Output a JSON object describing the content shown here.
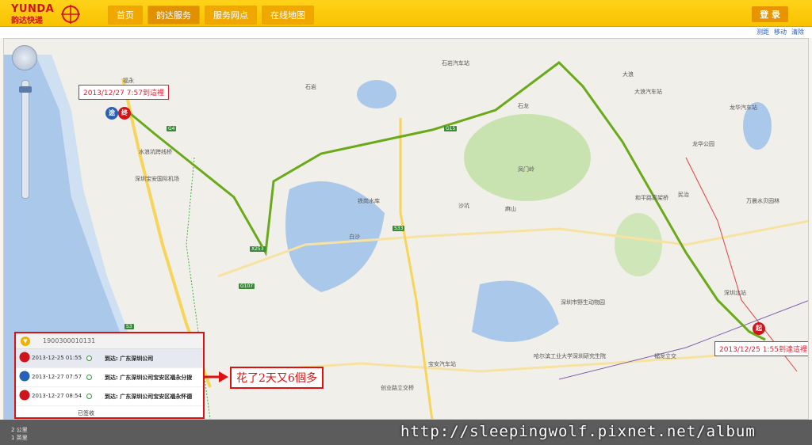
{
  "brand": {
    "name_en": "YUNDA",
    "name_cn": "韵达快递"
  },
  "nav": [
    {
      "label": "首页",
      "active": false
    },
    {
      "label": "韵达服务",
      "active": true
    },
    {
      "label": "服务网点",
      "active": false
    },
    {
      "label": "在线地图",
      "active": false
    }
  ],
  "login_label": "登 录",
  "tools": [
    "测距",
    "移动",
    "清除"
  ],
  "map_labels": [
    "福永",
    "水浪坑跨线桥",
    "深圳宝安国际机场",
    "G4",
    "G15",
    "石岩汽车站",
    "大浪",
    "龙华汽车站",
    "铁岗水库",
    "白沙",
    "S33",
    "X253",
    "G107",
    "S3",
    "宝安汽车站",
    "创业路立交桥",
    "福龙立交",
    "深圳市野生动物园",
    "哈尔滨工业大学深圳研究生院",
    "和平路高架桥",
    "民治",
    "深圳北站",
    "石龙",
    "龙华公园",
    "万晨水贝园林",
    "沙坑",
    "麻山",
    "凤门岭",
    "大浪汽车站",
    "石岩"
  ],
  "callouts": {
    "destination": "2013/12/27 7:57到這裡",
    "origin": "2013/12/25 1:55到達這裡"
  },
  "panel": {
    "tracking_number": "1900300010131",
    "rows": [
      {
        "icon": "起",
        "time": "2013-12-25 01:55",
        "place": "到达: 广东深圳公司"
      },
      {
        "icon": "途",
        "time": "2013-12-27 07:57",
        "place": "到达: 广东深圳公司宝安区福永分拨"
      },
      {
        "icon": "终",
        "time": "2013-12-27 08:54",
        "place": "到达: 广东深圳公司宝安区福永怀德"
      }
    ],
    "status": "已签收"
  },
  "annotation": "花了2天又6個多",
  "scale": {
    "km": "2 公里",
    "mi": "1 英里"
  },
  "watermark": "http://sleepingwolf.pixnet.net/album",
  "colors": {
    "header": "#ffd21a",
    "route": "#6aaa1a",
    "highlight": "#e01010"
  }
}
